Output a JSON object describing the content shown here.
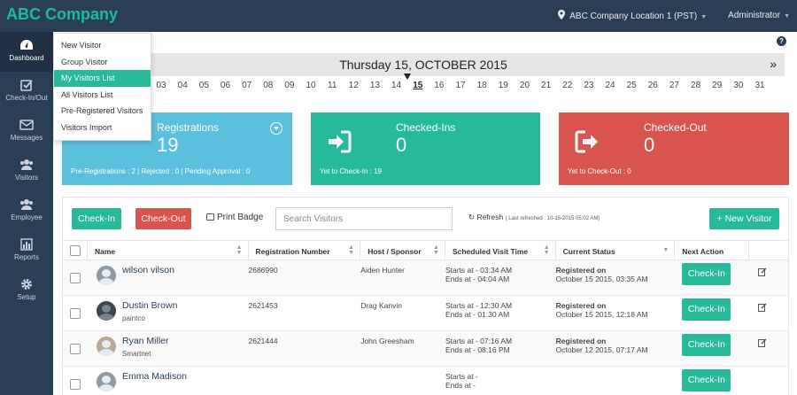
{
  "app": {
    "brand": "ABC Company",
    "location": "ABC Company Location 1 (PST)",
    "user": "Administrator"
  },
  "colors": {
    "nav_bg": "#2a3f54",
    "accent_green": "#26b99a",
    "info_blue": "#5bc0de",
    "danger_red": "#d9534f"
  },
  "sidebar": {
    "items": [
      {
        "label": "Dashboard",
        "icon": "dashboard-icon",
        "active": true
      },
      {
        "label": "Check-In/Out",
        "icon": "checkbox-icon"
      },
      {
        "label": "Messages",
        "icon": "envelope-icon"
      },
      {
        "label": "Visitors",
        "icon": "users-icon"
      },
      {
        "label": "Employee",
        "icon": "users-icon"
      },
      {
        "label": "Reports",
        "icon": "bar-chart-icon"
      },
      {
        "label": "Setup",
        "icon": "gear-icon"
      }
    ]
  },
  "dropdown": {
    "items": [
      "New Visitor",
      "Group Visitor",
      "My Visitors List",
      "All Visitors List",
      "Pre-Registered Visitors",
      "Visitors Import"
    ],
    "selected": "My Visitors List"
  },
  "date_bar": {
    "title": "Thursday 15, OCTOBER 2015",
    "next": "»",
    "days": [
      "03",
      "04",
      "05",
      "06",
      "07",
      "08",
      "09",
      "10",
      "11",
      "12",
      "13",
      "14",
      "15",
      "16",
      "17",
      "18",
      "19",
      "20",
      "21",
      "22",
      "23",
      "24",
      "25",
      "26",
      "27",
      "28",
      "29",
      "30",
      "31"
    ],
    "current_day": "15"
  },
  "cards": {
    "registrations": {
      "title": "Registrations",
      "count": "19",
      "footer": "Pre-Registrations : 2 | Rejected : 0 | Pending Approval : 0"
    },
    "checked_in": {
      "title": "Checked-Ins",
      "count": "0",
      "footer": "Yet to Check-In : 19"
    },
    "checked_out": {
      "title": "Checked-Out",
      "count": "0",
      "footer": "Yet to Check-Out : 0"
    }
  },
  "toolbar": {
    "checkin_label": "Check-In",
    "checkout_label": "Check-Out",
    "print_label": "Print Badge",
    "search_placeholder": "Search Visitors",
    "refresh_label": "Refresh",
    "refresh_note": "( Last refreshed : 10-15-2015 05:02 AM)",
    "new_visitor_label": "+ New Visitor"
  },
  "table": {
    "headers": {
      "name": "Name",
      "registration": "Registration Number",
      "host": "Host / Sponsor",
      "time": "Scheduled Visit Time",
      "status": "Current Status",
      "action": "Next Action"
    },
    "rows": [
      {
        "name": "wilson vilson",
        "company": "",
        "reg": "2686990",
        "host": "Aiden Hunter",
        "starts": "Starts at - 03:34 AM",
        "ends": "Ends at - 04:04 AM",
        "status": "Registered on",
        "status_date": "October 15 2015, 03:35 AM",
        "action": "Check-In"
      },
      {
        "name": "Dustin Brown",
        "company": "paintco",
        "reg": "2621453",
        "host": "Drag Kanvin",
        "starts": "Starts at - 12:30 AM",
        "ends": "Ends at - 01:30 AM",
        "status": "Registered on",
        "status_date": "October 15 2015, 12:18 AM",
        "action": "Check-In"
      },
      {
        "name": "Ryan Miller",
        "company": "Smartnet",
        "reg": "2621444",
        "host": "John Greesham",
        "starts": "Starts at - 07:16 AM",
        "ends": "Ends at - 08:16 PM",
        "status": "Registered on",
        "status_date": "October 12 2015, 07:17 AM",
        "action": "Check-In"
      },
      {
        "name": "Emma Madison",
        "company": "",
        "reg": "",
        "host": "",
        "starts": "Starts at -",
        "ends": "Ends at -",
        "status": "",
        "status_date": "",
        "action": "Check-In"
      }
    ]
  }
}
